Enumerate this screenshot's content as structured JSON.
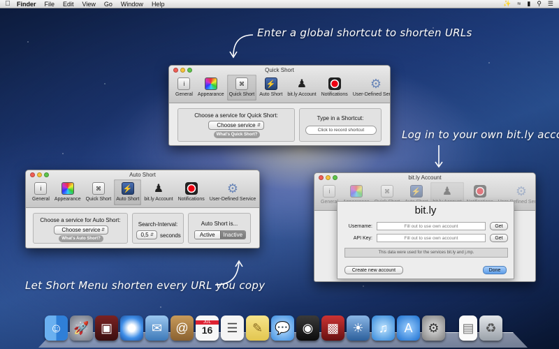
{
  "menubar": {
    "items": [
      "Finder",
      "File",
      "Edit",
      "View",
      "Go",
      "Window",
      "Help"
    ]
  },
  "annotations": {
    "top": "Enter a global shortcut to shorten URLs",
    "right": "Log in to your own bit.ly account",
    "left": "Let Short Menu shorten every URL you copy"
  },
  "toolbar": {
    "general": "General",
    "appearance": "Appearance",
    "quick_short": "Quick Short",
    "auto_short": "Auto Short",
    "bitly_account": "bit.ly Account",
    "notifications": "Notifications",
    "user_defined": "User-Defined Service"
  },
  "quick_short_window": {
    "title": "Quick Short",
    "choose_label": "Choose a service for Quick Short:",
    "choose_value": "Choose service",
    "help_pill": "What's Quick Short?",
    "shortcut_label": "Type in a Shortcut:",
    "shortcut_field": "Click to record shortcut"
  },
  "auto_short_window": {
    "title": "Auto Short",
    "choose_label": "Choose a service for Auto Short:",
    "choose_value": "Choose service",
    "help_pill": "What's Auto Short?",
    "interval_label": "Search-Interval:",
    "interval_value": "0,5",
    "interval_unit": "seconds",
    "status_label": "Auto Short is...",
    "active": "Active",
    "inactive": "Inactive"
  },
  "bitly_window": {
    "title": "bit.ly Account",
    "logo": "bit.ly",
    "username_label": "Username:",
    "username_placeholder": "Fill out to use own account",
    "apikey_label": "API Key:",
    "apikey_placeholder": "Fill out to use own account",
    "get": "Get",
    "info": "This data were used for the services bit.ly and j.mp.",
    "create": "Create new account",
    "done": "Done"
  },
  "calendar_icon": {
    "month": "JUL",
    "day": "16"
  },
  "dock": {
    "items": [
      "finder-icon",
      "launchpad-icon",
      "photo-booth-icon",
      "safari-icon",
      "mail-icon",
      "contacts-icon",
      "calendar-icon",
      "reminders-icon",
      "notes-icon",
      "messages-icon",
      "facetime-icon",
      "photo-icon",
      "iphoto-icon",
      "itunes-icon",
      "app-store-icon",
      "system-preferences-icon",
      "documents-icon",
      "trash-icon"
    ]
  }
}
